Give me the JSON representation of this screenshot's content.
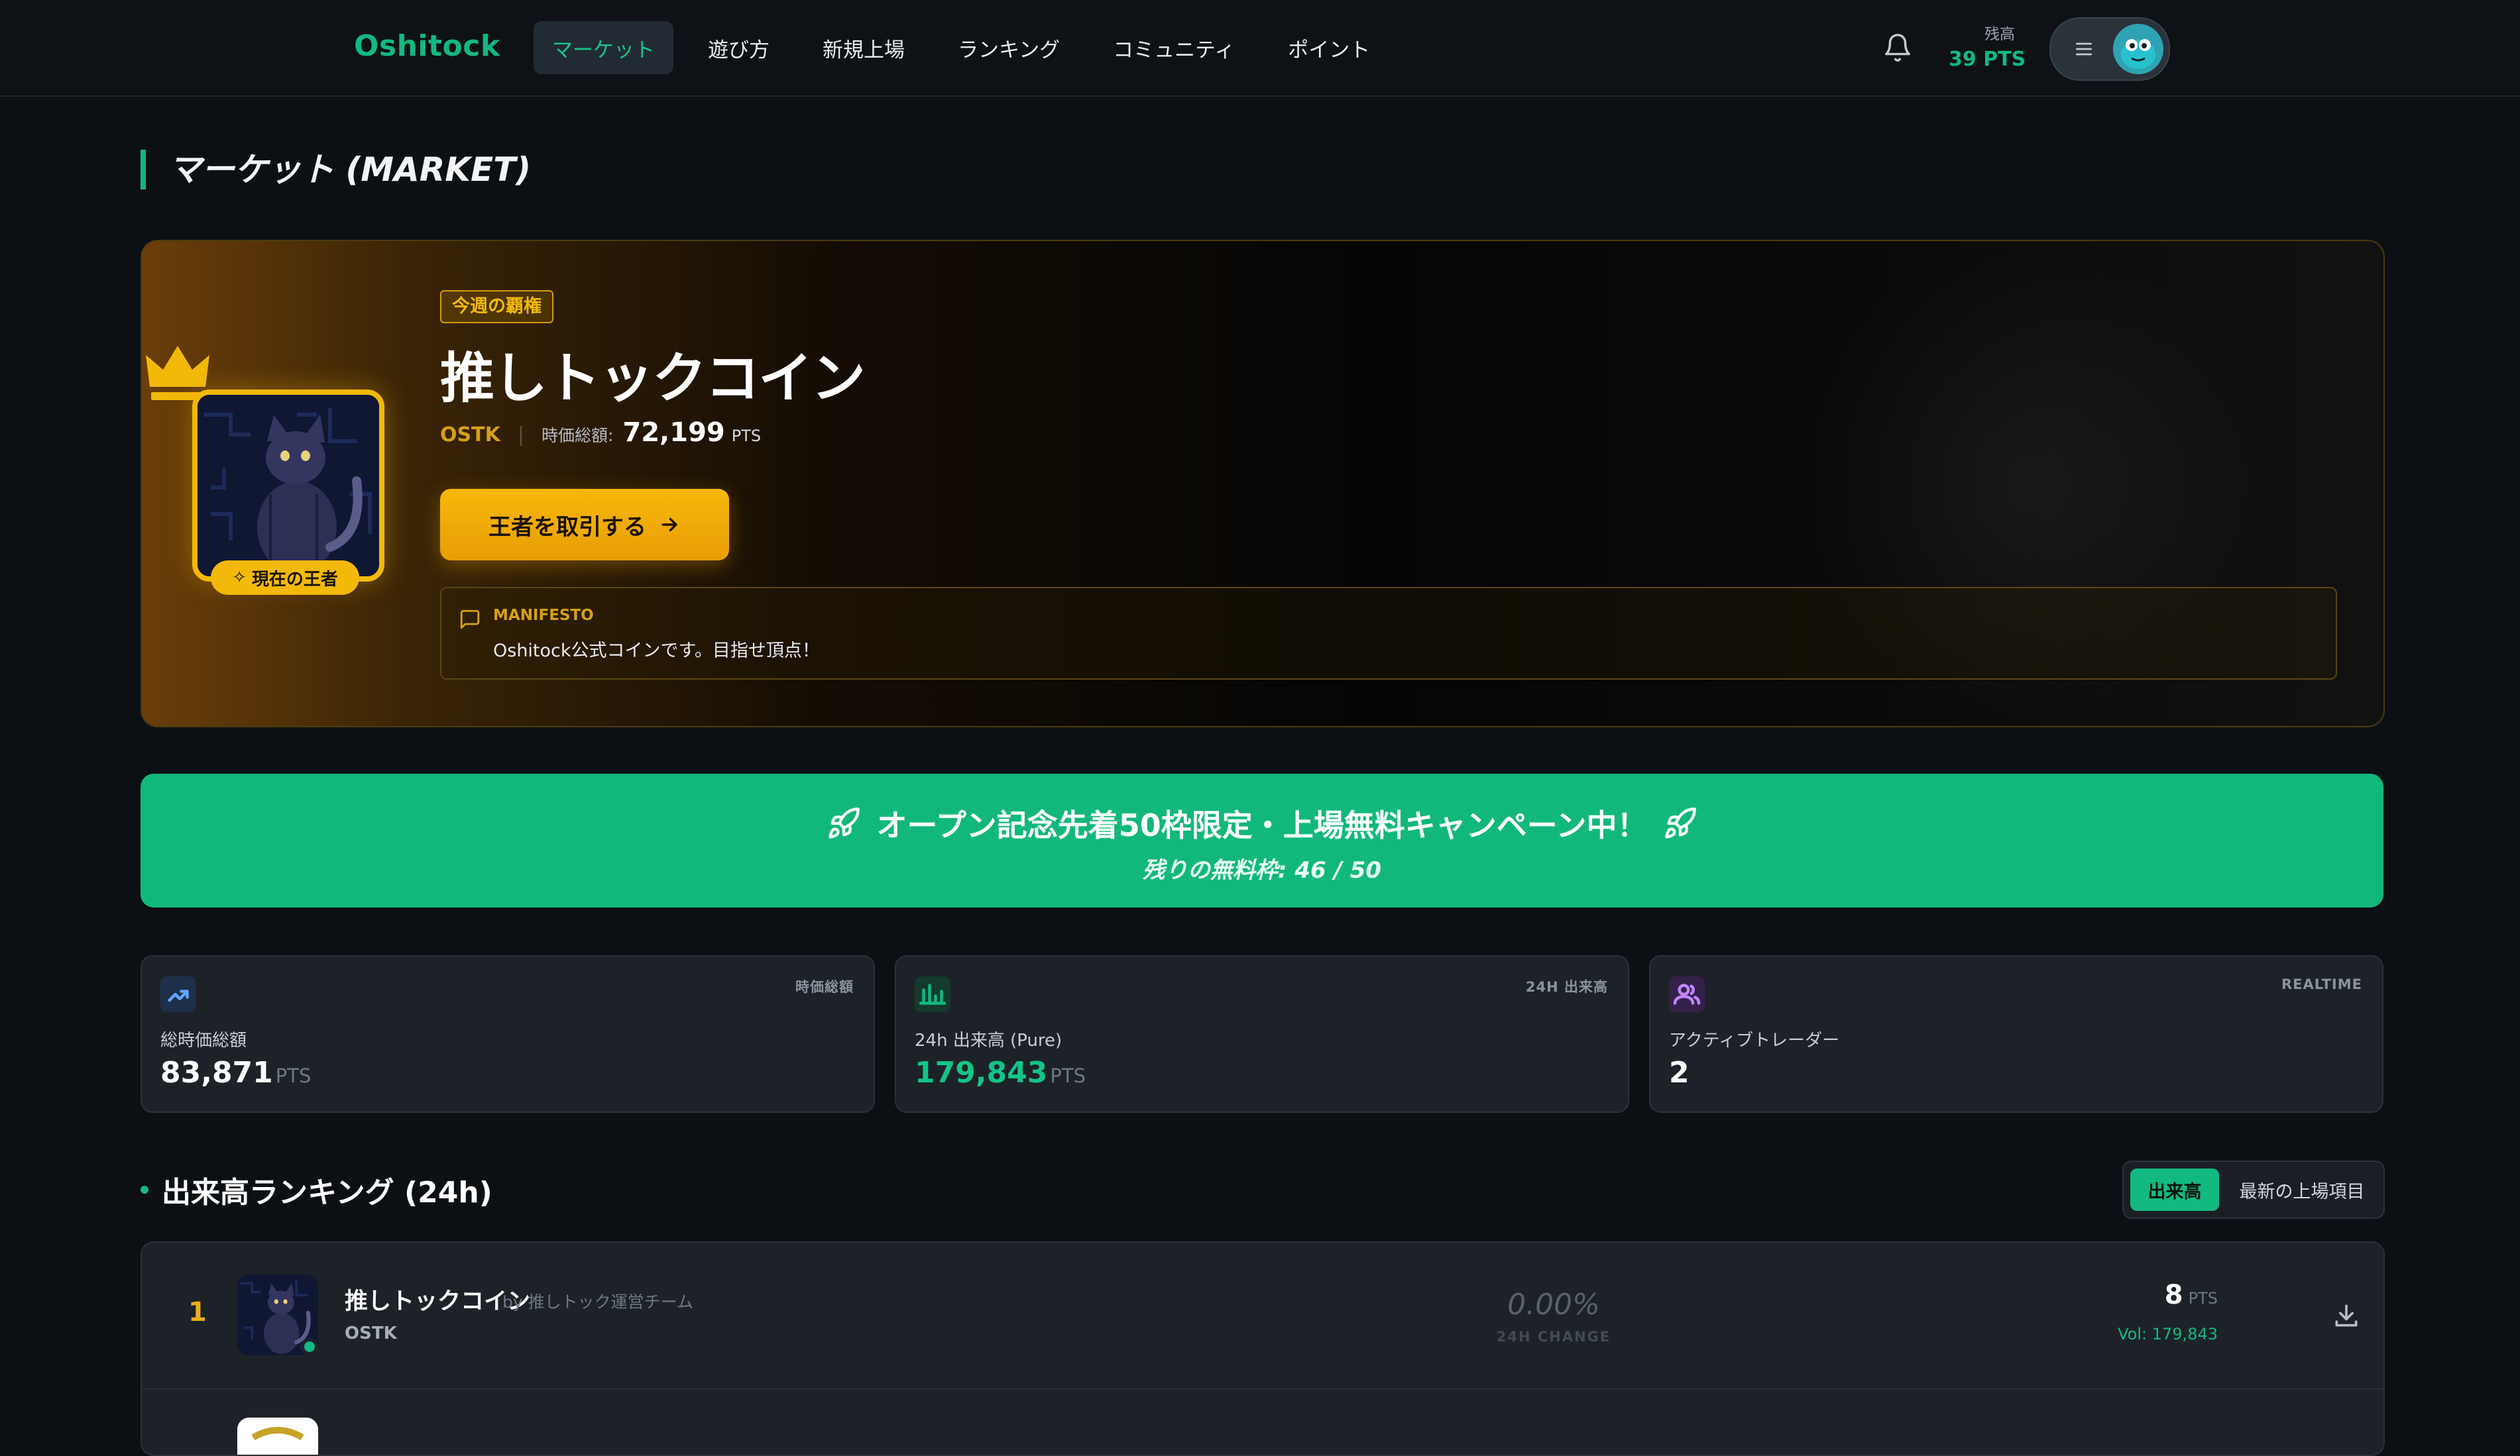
{
  "app": {
    "name": "Oshitock"
  },
  "nav": [
    {
      "label": "マーケット",
      "active": true
    },
    {
      "label": "遊び方"
    },
    {
      "label": "新規上場"
    },
    {
      "label": "ランキング"
    },
    {
      "label": "コミュニティ"
    },
    {
      "label": "ポイント"
    }
  ],
  "balance": {
    "label": "残高",
    "value": "39 PTS"
  },
  "page": {
    "title": "マーケット (MARKET)"
  },
  "hero": {
    "tag": "今週の覇権",
    "title": "推しトックコイン",
    "symbol": "OSTK",
    "cap_label": "時価総額:",
    "cap_value": "72,199",
    "cap_unit": "PTS",
    "badge": "現在の王者",
    "button": "王者を取引する",
    "manifesto_label": "MANIFESTO",
    "manifesto_text": "Oshitock公式コインです。目指せ頂点！"
  },
  "campaign": {
    "headline": "オープン記念先着50枠限定・上場無料キャンペーン中！",
    "remaining": "残りの無料枠: 46 / 50"
  },
  "stats": [
    {
      "corner": "時価総額",
      "label": "総時価総額",
      "value": "83,871",
      "unit": "PTS",
      "icon": "trend-up-icon",
      "color": "#3b82f6"
    },
    {
      "corner": "24H 出来高",
      "label": "24h 出来高 (Pure)",
      "value": "179,843",
      "unit": "PTS",
      "icon": "bar-chart-icon",
      "color": "#12b981"
    },
    {
      "corner": "REALTIME",
      "label": "アクティブトレーダー",
      "value": "2",
      "unit": "",
      "icon": "users-icon",
      "color": "#a855f7"
    }
  ],
  "ranking": {
    "title": "出来高ランキング (24h)",
    "tabs": [
      "出来高",
      "最新の上場項目"
    ],
    "rows": [
      {
        "rank": "1",
        "name": "推しトックコイン",
        "by": "by 推しトック運営チーム",
        "symbol": "OSTK",
        "change": "0.00%",
        "change_label": "24H CHANGE",
        "price": "8",
        "price_unit": "PTS",
        "volume": "Vol: 179,843"
      }
    ]
  },
  "colors": {
    "accent": "#12b981",
    "gold": "#f2b90a",
    "background": "#0c1014"
  }
}
